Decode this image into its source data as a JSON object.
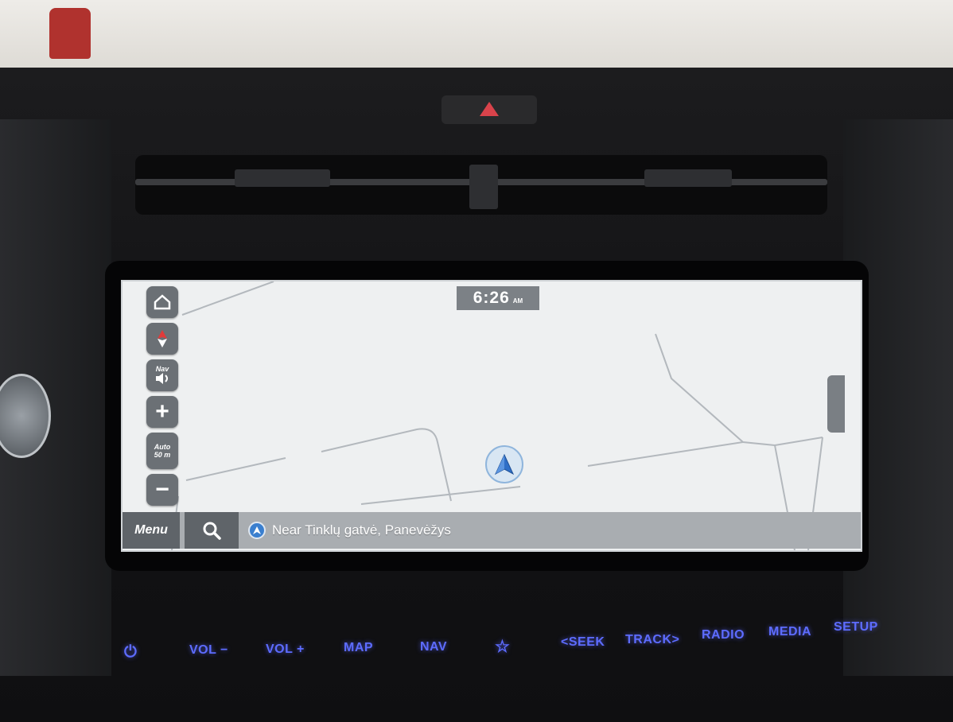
{
  "status": {
    "time": "6:26",
    "ampm": "AM"
  },
  "map_controls": {
    "home_icon": "home-icon",
    "compass_icon": "compass-icon",
    "nav_volume_label": "Nav",
    "zoom_in_label": "+",
    "scale_label_line1": "Auto",
    "scale_label_line2": "50 m",
    "zoom_out_label": "−"
  },
  "bottom_bar": {
    "menu_label": "Menu",
    "search_icon": "search-icon",
    "location_text": "Near Tinklų gatvė, Panevėžys"
  },
  "hard_keys": {
    "power": "⏻",
    "vol_down": "VOL −",
    "vol_up": "VOL +",
    "map": "MAP",
    "nav": "NAV",
    "favorite": "☆",
    "seek": "<SEEK",
    "track": "TRACK>",
    "radio": "RADIO",
    "media": "MEDIA",
    "setup": "SETUP"
  },
  "colors": {
    "hard_key_glow": "#5d6cff",
    "map_background": "#eef0f1",
    "location_marker": "#3a7fcf"
  }
}
